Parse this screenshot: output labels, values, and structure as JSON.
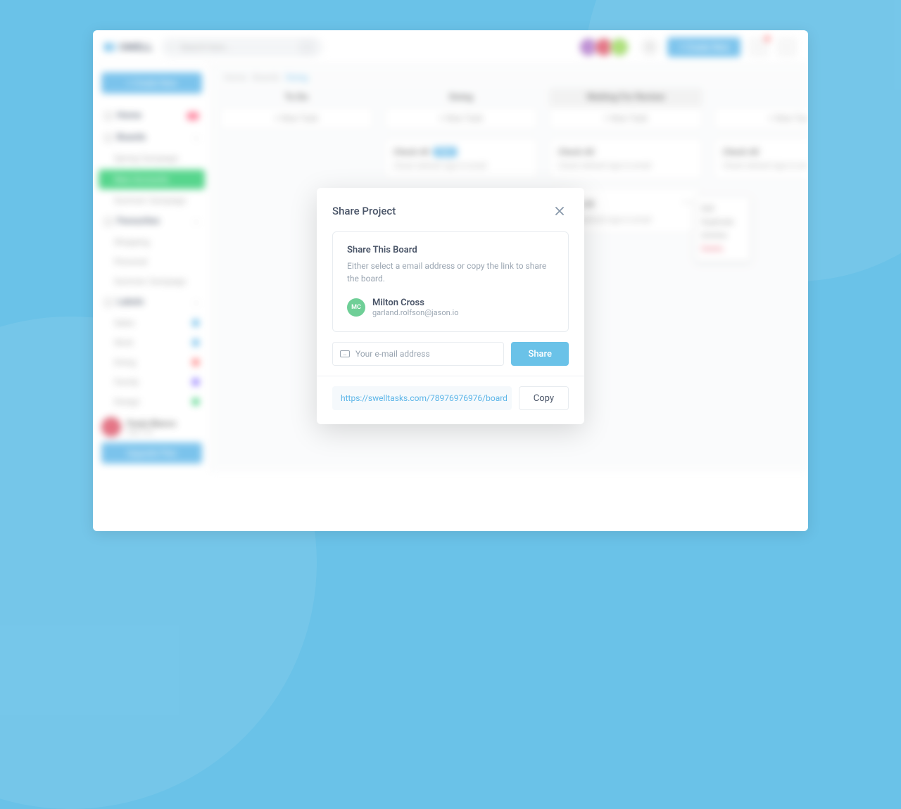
{
  "app": {
    "name": "SWELL"
  },
  "topbar": {
    "search_placeholder": "Search here...",
    "create_label": "+ Create New"
  },
  "sidebar": {
    "create_label": "+ Create New",
    "home": "Home",
    "home_badge": "15",
    "boards": "Boards",
    "board_items": [
      "Spring Campaign",
      "New Accounts",
      "Summer Campaign"
    ],
    "favourites": "Favourites",
    "fav_items": [
      "Shopping",
      "Personal",
      "Summer Campaign"
    ],
    "labels": "Labels",
    "label_items": [
      {
        "name": "Sales",
        "color": "#5bb5e8"
      },
      {
        "name": "Work",
        "color": "#5bb5e8"
      },
      {
        "name": "Doing",
        "color": "#ff6b6b"
      },
      {
        "name": "Family",
        "color": "#7b61ff"
      },
      {
        "name": "Design",
        "color": "#2ecc71"
      }
    ],
    "user_name": "Paula Blanco",
    "user_sub": "Sign Out",
    "upgrade": "Upgrade Plan"
  },
  "board": {
    "crumb1": "Home",
    "crumb2": "Boards",
    "crumb3": "Doing",
    "columns": [
      "To Do",
      "Doing",
      "Waiting For Review",
      ""
    ],
    "new_task": "+ New Task",
    "card_title": "Check All",
    "card_label": "Done",
    "card_desc": "Check default sign-in email",
    "menu": {
      "edit": "Edit",
      "duplicate": "Duplicate",
      "archive": "Archive",
      "delete": "Delete"
    }
  },
  "modal": {
    "title": "Share Project",
    "box_title": "Share This Board",
    "box_desc": "Either select a email address or copy the link to share the board.",
    "user_initials": "MC",
    "user_name": "Milton Cross",
    "user_email": "garland.rolfson@jason.io",
    "email_placeholder": "Your e-mail address",
    "share_btn": "Share",
    "link": "https://swelltasks.com/78976976976/board",
    "copy_btn": "Copy"
  }
}
